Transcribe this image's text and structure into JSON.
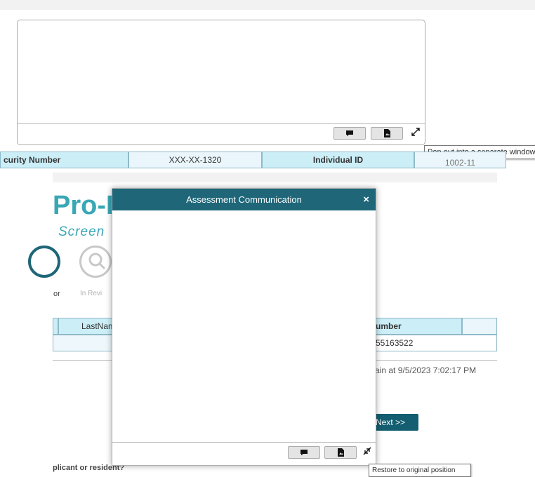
{
  "top_editor": {
    "toolbar": {
      "comment_icon": "speech-bubble-icon",
      "file_icon": "document-icon",
      "expand_icon": "expand-arrows-icon"
    },
    "tooltip": "Pop out into a separate window"
  },
  "info_row": {
    "ssn_label": "curity Number",
    "ssn_value": "XXX-XX-1320",
    "id_label": "Individual ID",
    "id_value": "1002-11"
  },
  "background": {
    "logo": "Pro-I",
    "subtitle": "Screen",
    "step_partial": "or",
    "step_in_review": "In Revi",
    "lastname_header": "LastNam",
    "number_header": "umber",
    "number_value": "55163522",
    "timestamp_text": "ain at 9/5/2023 7:02:17 PM",
    "next_button": "Next >>",
    "question_text": "plicant or resident?"
  },
  "modal": {
    "title": "Assessment Communication",
    "close": "×",
    "toolbar": {
      "comment_icon": "speech-bubble-icon",
      "file_icon": "document-icon",
      "collapse_icon": "collapse-arrows-icon"
    },
    "tooltip": "Restore to original position"
  },
  "colors": {
    "header_teal": "#1e6678",
    "brand_teal": "#3aa7b5",
    "table_header_bg": "#cceef7",
    "next_button_bg": "#135e70"
  }
}
